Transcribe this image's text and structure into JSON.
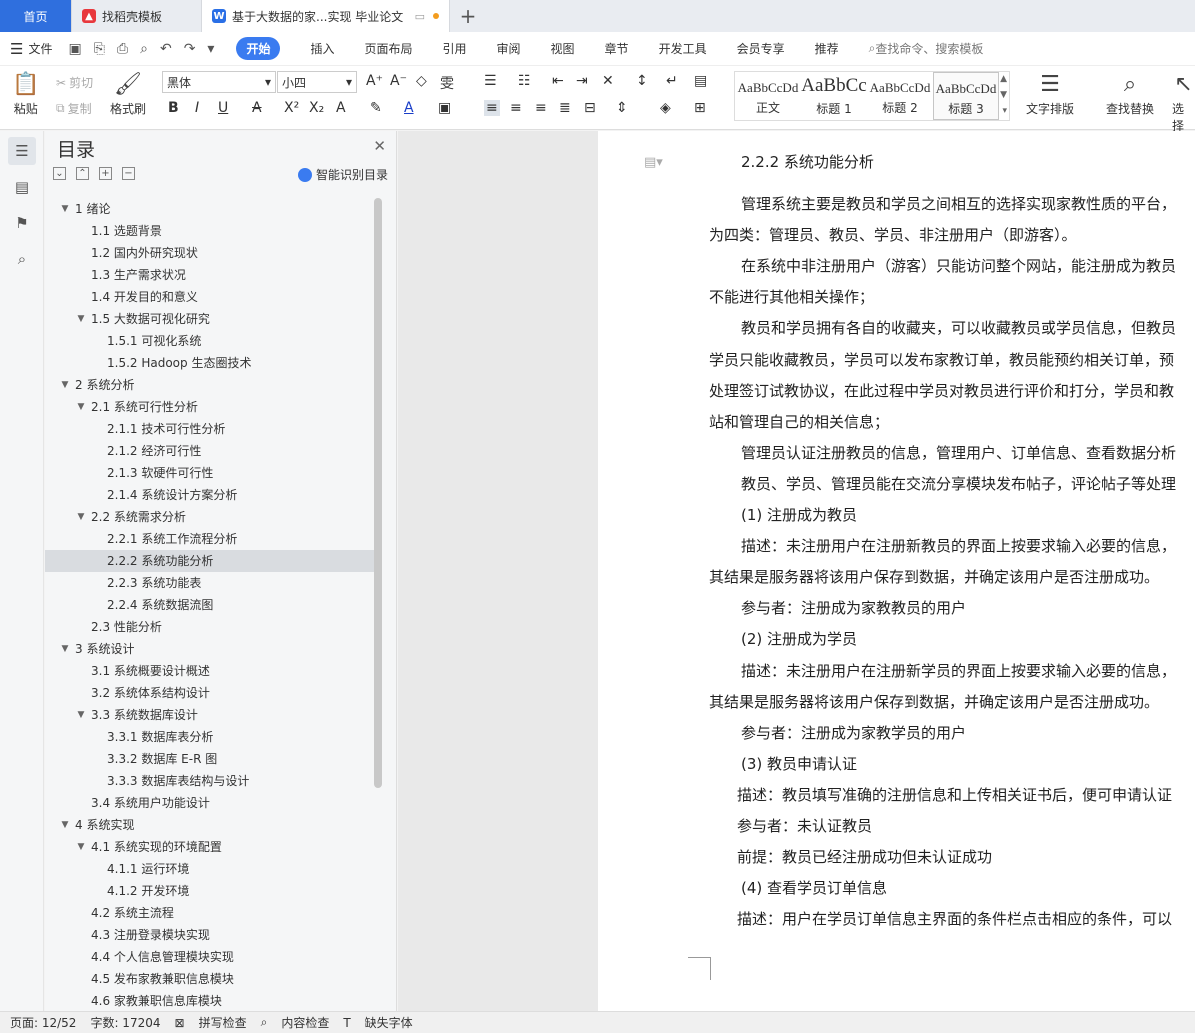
{
  "tabs": {
    "home": "首页",
    "docer": "找稻壳模板",
    "doc": "基于大数据的家...实现 毕业论文",
    "docer_icon": "docer-icon",
    "doc_icon": "wps-writer-icon",
    "unsaved_dot_color": "#f39c1e"
  },
  "menu": {
    "file": "文件",
    "items": [
      "开始",
      "插入",
      "页面布局",
      "引用",
      "审阅",
      "视图",
      "章节",
      "开发工具",
      "会员专享",
      "推荐"
    ],
    "search": "查找命令、搜索模板",
    "accent": "#3a7bf0"
  },
  "ribbon": {
    "paste": "粘贴",
    "cut": "剪切",
    "copy": "复制",
    "format_painter": "格式刷",
    "font_name": "黑体",
    "font_size": "小四",
    "styles": [
      {
        "preview": "AaBbCcDd",
        "name": "正文"
      },
      {
        "preview": "AaBbCc",
        "name": "标题 1"
      },
      {
        "preview": "AaBbCcDd",
        "name": "标题 2"
      },
      {
        "preview": "AaBbCcDd",
        "name": "标题 3"
      }
    ],
    "text_layout": "文字排版",
    "find_replace": "查找替换",
    "select": "选择"
  },
  "toc": {
    "title": "目录",
    "smart": "智能识别目录",
    "items": [
      {
        "text": "1  绪论",
        "level": 1,
        "caret": "v"
      },
      {
        "text": "1.1  选题背景",
        "level": 2,
        "caret": ""
      },
      {
        "text": "1.2  国内外研究现状",
        "level": 2,
        "caret": ""
      },
      {
        "text": "1.3  生产需求状况",
        "level": 2,
        "caret": ""
      },
      {
        "text": "1.4  开发目的和意义",
        "level": 2,
        "caret": ""
      },
      {
        "text": "1.5  大数据可视化研究",
        "level": 2,
        "caret": "v"
      },
      {
        "text": "1.5.1  可视化系统",
        "level": 3,
        "caret": ""
      },
      {
        "text": "1.5.2 Hadoop 生态圈技术",
        "level": 3,
        "caret": ""
      },
      {
        "text": "2  系统分析",
        "level": 1,
        "caret": "v"
      },
      {
        "text": "2.1  系统可行性分析",
        "level": 2,
        "caret": "v"
      },
      {
        "text": "2.1.1  技术可行性分析",
        "level": 3,
        "caret": ""
      },
      {
        "text": "2.1.2  经济可行性",
        "level": 3,
        "caret": ""
      },
      {
        "text": "2.1.3  软硬件可行性",
        "level": 3,
        "caret": ""
      },
      {
        "text": "2.1.4  系统设计方案分析",
        "level": 3,
        "caret": ""
      },
      {
        "text": "2.2  系统需求分析",
        "level": 2,
        "caret": "v"
      },
      {
        "text": "2.2.1  系统工作流程分析",
        "level": 3,
        "caret": ""
      },
      {
        "text": "2.2.2  系统功能分析",
        "level": 3,
        "caret": "",
        "selected": true
      },
      {
        "text": "2.2.3  系统功能表",
        "level": 3,
        "caret": ""
      },
      {
        "text": "2.2.4  系统数据流图",
        "level": 3,
        "caret": ""
      },
      {
        "text": "2.3  性能分析",
        "level": 2,
        "caret": ""
      },
      {
        "text": "3  系统设计",
        "level": 1,
        "caret": "v"
      },
      {
        "text": "3.1  系统概要设计概述",
        "level": 2,
        "caret": ""
      },
      {
        "text": "3.2  系统体系结构设计",
        "level": 2,
        "caret": ""
      },
      {
        "text": "3.3  系统数据库设计",
        "level": 2,
        "caret": "v"
      },
      {
        "text": "3.3.1  数据库表分析",
        "level": 3,
        "caret": ""
      },
      {
        "text": "3.3.2  数据库 E-R 图",
        "level": 3,
        "caret": ""
      },
      {
        "text": "3.3.3  数据库表结构与设计",
        "level": 3,
        "caret": ""
      },
      {
        "text": "3.4  系统用户功能设计",
        "level": 2,
        "caret": ""
      },
      {
        "text": "4  系统实现",
        "level": 1,
        "caret": "v"
      },
      {
        "text": "4.1  系统实现的环境配置",
        "level": 2,
        "caret": "v"
      },
      {
        "text": "4.1.1  运行环境",
        "level": 3,
        "caret": ""
      },
      {
        "text": "4.1.2  开发环境",
        "level": 3,
        "caret": ""
      },
      {
        "text": "4.2  系统主流程",
        "level": 2,
        "caret": ""
      },
      {
        "text": "4.3  注册登录模块实现",
        "level": 2,
        "caret": ""
      },
      {
        "text": "4.4  个人信息管理模块实现",
        "level": 2,
        "caret": ""
      },
      {
        "text": "4.5  发布家教兼职信息模块",
        "level": 2,
        "caret": ""
      },
      {
        "text": "4.6  家教兼职信息库模块",
        "level": 2,
        "caret": ""
      }
    ]
  },
  "document": {
    "lines": [
      {
        "text": "2.2.2  系统功能分析",
        "indent": 32
      },
      {
        "text": "管理系统主要是教员和学员之间相互的选择实现家教性质的平台，",
        "indent": 32
      },
      {
        "text": "为四类：管理员、教员、学员、非注册用户（即游客）。",
        "indent": 0
      },
      {
        "text": "在系统中非注册用户（游客）只能访问整个网站，能注册成为教员",
        "indent": 32
      },
      {
        "text": "不能进行其他相关操作；",
        "indent": 0
      },
      {
        "text": "教员和学员拥有各自的收藏夹，可以收藏教员或学员信息，但教员",
        "indent": 32
      },
      {
        "text": "学员只能收藏教员，学员可以发布家教订单，教员能预约相关订单，预",
        "indent": 0
      },
      {
        "text": "处理签订试教协议，在此过程中学员对教员进行评价和打分，学员和教",
        "indent": 0
      },
      {
        "text": "站和管理自己的相关信息；",
        "indent": 0
      },
      {
        "text": "管理员认证注册教员的信息，管理用户、订单信息、查看数据分析",
        "indent": 32
      },
      {
        "text": "教员、学员、管理员能在交流分享模块发布帖子，评论帖子等处理",
        "indent": 32
      },
      {
        "text": "(1)  注册成为教员",
        "indent": 32
      },
      {
        "text": "描述：未注册用户在注册新教员的界面上按要求输入必要的信息，",
        "indent": 32
      },
      {
        "text": "其结果是服务器将该用户保存到数据，并确定该用户是否注册成功。",
        "indent": 0
      },
      {
        "text": "参与者：注册成为家教教员的用户",
        "indent": 32
      },
      {
        "text": "(2)  注册成为学员",
        "indent": 32
      },
      {
        "text": "描述：未注册用户在注册新学员的界面上按要求输入必要的信息，",
        "indent": 32
      },
      {
        "text": "其结果是服务器将该用户保存到数据，并确定该用户是否注册成功。",
        "indent": 0
      },
      {
        "text": "参与者：注册成为家教学员的用户",
        "indent": 32
      },
      {
        "text": "(3)  教员申请认证",
        "indent": 32
      },
      {
        "text": "描述：教员填写准确的注册信息和上传相关证书后，便可申请认证",
        "indent": 28
      },
      {
        "text": "参与者：未认证教员",
        "indent": 28
      },
      {
        "text": "前提：教员已经注册成功但未认证成功",
        "indent": 28
      },
      {
        "text": "(4)  查看学员订单信息",
        "indent": 32
      },
      {
        "text": "描述：用户在学员订单信息主界面的条件栏点击相应的条件，可以",
        "indent": 28
      }
    ]
  },
  "status": {
    "page": "页面: 12/52",
    "words": "字数: 17204",
    "spell": "拼写检查",
    "content_check": "内容检查",
    "missing_font": "缺失字体"
  }
}
